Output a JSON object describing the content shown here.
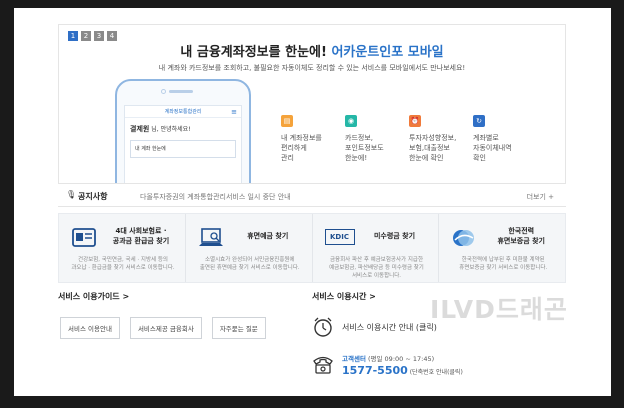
{
  "banner": {
    "pages": [
      "1",
      "2",
      "3",
      "4"
    ],
    "headline_main": "내 금융계좌정보를 한눈에! ",
    "headline_blue": "어카운트인포 모바일",
    "subline": "내 계좌와 카드정보를 조회하고, 불필요한 자동이체도 정리할 수 있는 서비스를 모바일에서도 만나보세요!",
    "phone": {
      "app_title": "계좌정보통합관리",
      "greet_name": "결제원",
      "greet_text": " 님, 안녕하세요!",
      "card_text": "내 계좌 한눈에"
    },
    "features": [
      {
        "icon": "wallet-icon",
        "color": "#f5a33b",
        "text": "내 계좌정보를\n편리하게\n관리"
      },
      {
        "icon": "eye-icon",
        "color": "#25b7a7",
        "text": "카드정보,\n포인트정보도\n한눈에!"
      },
      {
        "icon": "alarm-icon",
        "color": "#f07a3a",
        "text": "투자자성향정보,\n보험,대출정보\n한눈에 확인"
      },
      {
        "icon": "refresh-icon",
        "color": "#2f6fc6",
        "text": "계좌별로\n자동이체내역\n확인"
      }
    ]
  },
  "notice": {
    "label": "공지사항",
    "message": "다올투자증권의 계좌통합관리서비스 일시 중단 안내",
    "more": "더보기 +"
  },
  "services": [
    {
      "icon": "id-card-icon",
      "title": "4대 사회보험료 ·\n공과금 환급금 찾기",
      "desc": "건강보험, 국민연금, 국세 · 지방세 등의\n과오납 · 환급금을 찾기 서비스로 이동합니다."
    },
    {
      "icon": "laptop-icon",
      "title": "휴면예금 찾기",
      "desc": "소멸시효가 완성되어 서민금융진흥원에\n출연된 휴면예금 찾기 서비스로 이동합니다."
    },
    {
      "icon": "kdic-logo",
      "logo_text": "KDIC",
      "title": "미수령금 찾기",
      "desc": "금융회사 파산 후 예금보험공사가 지급한\n예금보험금, 파산배당금 등 미수령금 찾기\n서비스로 이동합니다."
    },
    {
      "icon": "kepco-logo",
      "title": "한국전력\n휴면보증금 찾기",
      "desc": "한국전력에 납부된 후 미환불 계약된\n휴면보증금 찾기 서비스로 이동합니다."
    }
  ],
  "guide": {
    "title": "서비스 이용가이드 >",
    "buttons": [
      "서비스 이용안내",
      "서비스제공 금융회사",
      "자주묻는 질문"
    ]
  },
  "time": {
    "title": "서비스 이용시간 >",
    "text": "서비스 이용시간 안내 (클릭)",
    "call_label": "고객센터",
    "call_hours": " (평일 09:00 ~ 17:45)",
    "call_number": "1577-5500",
    "call_note": " (단축번호 안내(클릭)"
  },
  "watermark": "ILVD드래곤"
}
